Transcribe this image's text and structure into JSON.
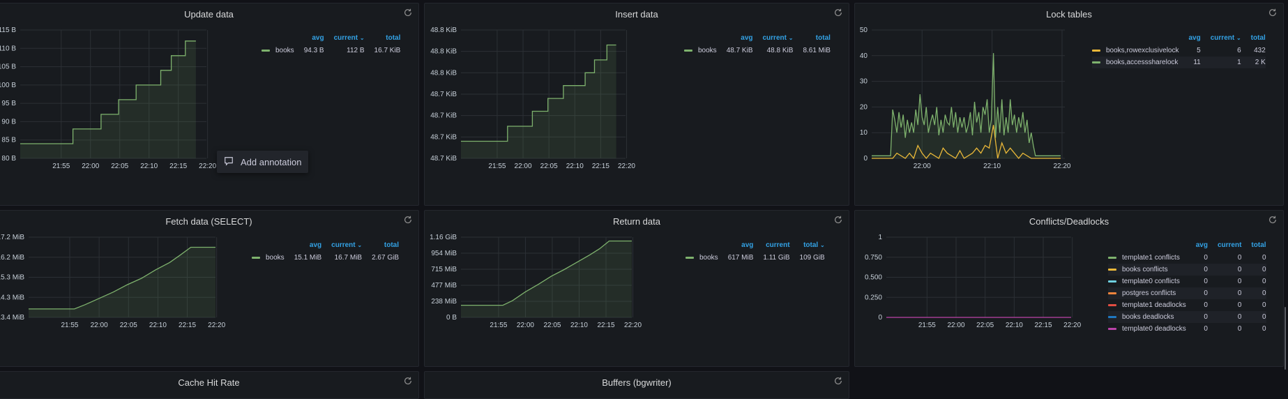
{
  "refresh_icon": "refresh-icon",
  "annotation_popup": {
    "label": "Add annotation",
    "icon": "comment-icon"
  },
  "panels": {
    "update": {
      "title": "Update data",
      "legend": {
        "headers": [
          "avg",
          "current",
          "total"
        ],
        "sorted": "current",
        "rows": [
          {
            "name": "books",
            "color": "#7eb26d",
            "avg": "94.3 B",
            "current": "112 B",
            "total": "16.7 KiB"
          }
        ]
      }
    },
    "insert": {
      "title": "Insert data",
      "legend": {
        "headers": [
          "avg",
          "current",
          "total"
        ],
        "sorted": "current",
        "rows": [
          {
            "name": "books",
            "color": "#7eb26d",
            "avg": "48.7 KiB",
            "current": "48.8 KiB",
            "total": "8.61 MiB"
          }
        ]
      }
    },
    "lock": {
      "title": "Lock tables",
      "legend": {
        "headers": [
          "avg",
          "current",
          "total"
        ],
        "sorted": "current",
        "rows": [
          {
            "name": "books,rowexclusivelock",
            "color": "#eab839",
            "avg": "5",
            "current": "6",
            "total": "432"
          },
          {
            "name": "books,accesssharelock",
            "color": "#7eb26d",
            "avg": "11",
            "current": "1",
            "total": "2 K"
          }
        ]
      }
    },
    "fetch": {
      "title": "Fetch data (SELECT)",
      "legend": {
        "headers": [
          "avg",
          "current",
          "total"
        ],
        "sorted": "current",
        "rows": [
          {
            "name": "books",
            "color": "#7eb26d",
            "avg": "15.1 MiB",
            "current": "16.7 MiB",
            "total": "2.67 GiB"
          }
        ]
      }
    },
    "return": {
      "title": "Return data",
      "legend": {
        "headers": [
          "avg",
          "current",
          "total"
        ],
        "sorted": "total",
        "rows": [
          {
            "name": "books",
            "color": "#7eb26d",
            "avg": "617 MiB",
            "current": "1.11 GiB",
            "total": "109 GiB"
          }
        ]
      }
    },
    "conflicts": {
      "title": "Conflicts/Deadlocks",
      "legend": {
        "headers": [
          "avg",
          "current",
          "total"
        ],
        "sorted": "",
        "rows": [
          {
            "name": "template1 conflicts",
            "color": "#7eb26d",
            "avg": "0",
            "current": "0",
            "total": "0"
          },
          {
            "name": "books conflicts",
            "color": "#eab839",
            "avg": "0",
            "current": "0",
            "total": "0"
          },
          {
            "name": "template0 conflicts",
            "color": "#6ed0e0",
            "avg": "0",
            "current": "0",
            "total": "0"
          },
          {
            "name": "postgres conflicts",
            "color": "#ef843c",
            "avg": "0",
            "current": "0",
            "total": "0"
          },
          {
            "name": "template1 deadlocks",
            "color": "#e24d42",
            "avg": "0",
            "current": "0",
            "total": "0"
          },
          {
            "name": "books deadlocks",
            "color": "#1f78c1",
            "avg": "0",
            "current": "0",
            "total": "0"
          },
          {
            "name": "template0 deadlocks",
            "color": "#ba43a9",
            "avg": "0",
            "current": "0",
            "total": "0"
          }
        ]
      }
    },
    "cache": {
      "title": "Cache Hit Rate"
    },
    "buffers": {
      "title": "Buffers (bgwriter)"
    }
  },
  "chart_data": [
    {
      "id": "update",
      "type": "line",
      "title": "Update data",
      "x_ticks": [
        "21:55",
        "22:00",
        "22:05",
        "22:10",
        "22:15",
        "22:20"
      ],
      "y_ticks": [
        "80 B",
        "85 B",
        "90 B",
        "95 B",
        "100 B",
        "105 B",
        "110 B",
        "115 B"
      ],
      "ylim": [
        80,
        115
      ],
      "xlim": [
        21.8,
        22.33
      ],
      "series": [
        {
          "name": "books",
          "color": "#7eb26d",
          "fill": true,
          "x": [
            21.8,
            21.95,
            21.95,
            22.03,
            22.03,
            22.08,
            22.08,
            22.13,
            22.13,
            22.2,
            22.2,
            22.23,
            22.23,
            22.27,
            22.27,
            22.3,
            22.3
          ],
          "y": [
            84,
            84,
            88,
            88,
            92,
            92,
            96,
            96,
            100,
            100,
            104,
            104,
            108,
            108,
            112,
            112,
            112
          ]
        }
      ]
    },
    {
      "id": "insert",
      "type": "line",
      "title": "Insert data",
      "x_ticks": [
        "21:55",
        "22:00",
        "22:05",
        "22:10",
        "22:15",
        "22:20"
      ],
      "y_ticks": [
        "48.7 KiB",
        "48.7 KiB",
        "48.7 KiB",
        "48.7 KiB",
        "48.8 KiB",
        "48.8 KiB",
        "48.8 KiB"
      ],
      "ylim": [
        0,
        6
      ],
      "xlim": [
        21.8,
        22.33
      ],
      "series": [
        {
          "name": "books",
          "color": "#7eb26d",
          "fill": true,
          "x": [
            21.8,
            21.95,
            21.95,
            22.03,
            22.03,
            22.08,
            22.08,
            22.13,
            22.13,
            22.2,
            22.2,
            22.23,
            22.23,
            22.27,
            22.27,
            22.3,
            22.3
          ],
          "y": [
            0.8,
            0.8,
            1.5,
            1.5,
            2.2,
            2.2,
            2.8,
            2.8,
            3.4,
            3.4,
            4.0,
            4.0,
            4.6,
            4.6,
            5.3,
            5.3,
            5.3
          ]
        }
      ]
    },
    {
      "id": "lock",
      "type": "line",
      "title": "Lock tables",
      "x_ticks": [
        "22:00",
        "22:10",
        "22:20"
      ],
      "y_ticks": [
        "0",
        "10",
        "20",
        "30",
        "40",
        "50"
      ],
      "ylim": [
        0,
        50
      ],
      "xlim": [
        21.88,
        22.34
      ],
      "series": [
        {
          "name": "books,accesssharelock",
          "color": "#7eb26d",
          "fill": true,
          "x": [
            21.88,
            21.925,
            21.93,
            21.935,
            21.94,
            21.945,
            21.95,
            21.955,
            21.96,
            21.965,
            21.97,
            21.975,
            21.98,
            21.985,
            21.99,
            21.995,
            22.0,
            22.005,
            22.01,
            22.015,
            22.02,
            22.025,
            22.03,
            22.035,
            22.04,
            22.045,
            22.05,
            22.055,
            22.06,
            22.065,
            22.07,
            22.075,
            22.08,
            22.085,
            22.09,
            22.095,
            22.1,
            22.105,
            22.11,
            22.115,
            22.12,
            22.125,
            22.13,
            22.135,
            22.14,
            22.145,
            22.15,
            22.155,
            22.16,
            22.165,
            22.17,
            22.175,
            22.18,
            22.185,
            22.19,
            22.195,
            22.2,
            22.205,
            22.21,
            22.215,
            22.22,
            22.225,
            22.23,
            22.235,
            22.24,
            22.245,
            22.25,
            22.255,
            22.26,
            22.265,
            22.27,
            22.28,
            22.33
          ],
          "y": [
            1,
            1,
            19,
            15,
            10,
            18,
            12,
            17,
            8,
            15,
            10,
            14,
            10,
            19,
            13,
            25,
            16,
            13,
            20,
            10,
            14,
            17,
            13,
            20,
            9,
            15,
            10,
            17,
            14,
            13,
            20,
            12,
            18,
            10,
            16,
            12,
            16,
            10,
            13,
            18,
            9,
            22,
            14,
            18,
            10,
            20,
            17,
            23,
            10,
            15,
            41,
            8,
            20,
            10,
            23,
            9,
            16,
            10,
            23,
            13,
            17,
            10,
            16,
            12,
            18,
            10,
            15,
            6,
            10,
            5,
            1,
            1,
            1
          ]
        },
        {
          "name": "books,rowexclusivelock",
          "color": "#eab839",
          "fill": false,
          "x": [
            21.88,
            21.93,
            21.94,
            21.96,
            21.97,
            21.98,
            21.99,
            22.0,
            22.01,
            22.02,
            22.04,
            22.05,
            22.06,
            22.08,
            22.09,
            22.1,
            22.12,
            22.13,
            22.14,
            22.15,
            22.16,
            22.17,
            22.18,
            22.19,
            22.2,
            22.21,
            22.22,
            22.23,
            22.24,
            22.26,
            22.27,
            22.33
          ],
          "y": [
            0,
            0,
            2,
            0,
            2,
            0,
            5,
            2,
            0,
            2,
            0,
            4,
            2,
            0,
            3,
            0,
            2,
            4,
            2,
            5,
            4,
            13,
            0,
            6,
            2,
            4,
            2,
            0,
            2,
            0,
            0,
            0
          ]
        }
      ]
    },
    {
      "id": "fetch",
      "type": "line",
      "title": "Fetch data (SELECT)",
      "x_ticks": [
        "21:55",
        "22:00",
        "22:05",
        "22:10",
        "22:15",
        "22:20"
      ],
      "y_ticks": [
        "13.4 MiB",
        "14.3 MiB",
        "15.3 MiB",
        "16.2 MiB",
        "17.2 MiB"
      ],
      "ylim": [
        13.4,
        17.2
      ],
      "xlim": [
        21.8,
        22.33
      ],
      "series": [
        {
          "name": "books",
          "color": "#7eb26d",
          "fill": true,
          "x": [
            21.8,
            21.93,
            21.96,
            22.0,
            22.04,
            22.08,
            22.12,
            22.16,
            22.2,
            22.23,
            22.26,
            22.28,
            22.33
          ],
          "y": [
            13.8,
            13.8,
            14.0,
            14.3,
            14.6,
            14.95,
            15.25,
            15.65,
            16.0,
            16.35,
            16.72,
            16.72,
            16.72
          ]
        }
      ]
    },
    {
      "id": "return",
      "type": "line",
      "title": "Return data",
      "x_ticks": [
        "21:55",
        "22:00",
        "22:05",
        "22:10",
        "22:15",
        "22:20"
      ],
      "y_ticks": [
        "0 B",
        "238 MiB",
        "477 MiB",
        "715 MiB",
        "954 MiB",
        "1.16 GiB"
      ],
      "ylim": [
        0,
        1192
      ],
      "xlim": [
        21.8,
        22.33
      ],
      "series": [
        {
          "name": "books",
          "color": "#7eb26d",
          "fill": true,
          "x": [
            21.8,
            21.93,
            21.96,
            22.0,
            22.04,
            22.08,
            22.12,
            22.16,
            22.2,
            22.23,
            22.26,
            22.28,
            22.33
          ],
          "y": [
            180,
            180,
            250,
            380,
            490,
            610,
            710,
            820,
            930,
            1020,
            1135,
            1135,
            1135
          ]
        }
      ]
    },
    {
      "id": "conflicts",
      "type": "line",
      "title": "Conflicts/Deadlocks",
      "x_ticks": [
        "21:55",
        "22:00",
        "22:05",
        "22:10",
        "22:15",
        "22:20"
      ],
      "y_ticks": [
        "0",
        "0.250",
        "0.500",
        "0.750",
        "1"
      ],
      "ylim": [
        0,
        1
      ],
      "xlim": [
        21.8,
        22.33
      ],
      "series": [
        {
          "name": "template0 deadlocks",
          "color": "#ba43a9",
          "fill": false,
          "x": [
            21.8,
            22.33
          ],
          "y": [
            0,
            0
          ]
        }
      ]
    }
  ]
}
